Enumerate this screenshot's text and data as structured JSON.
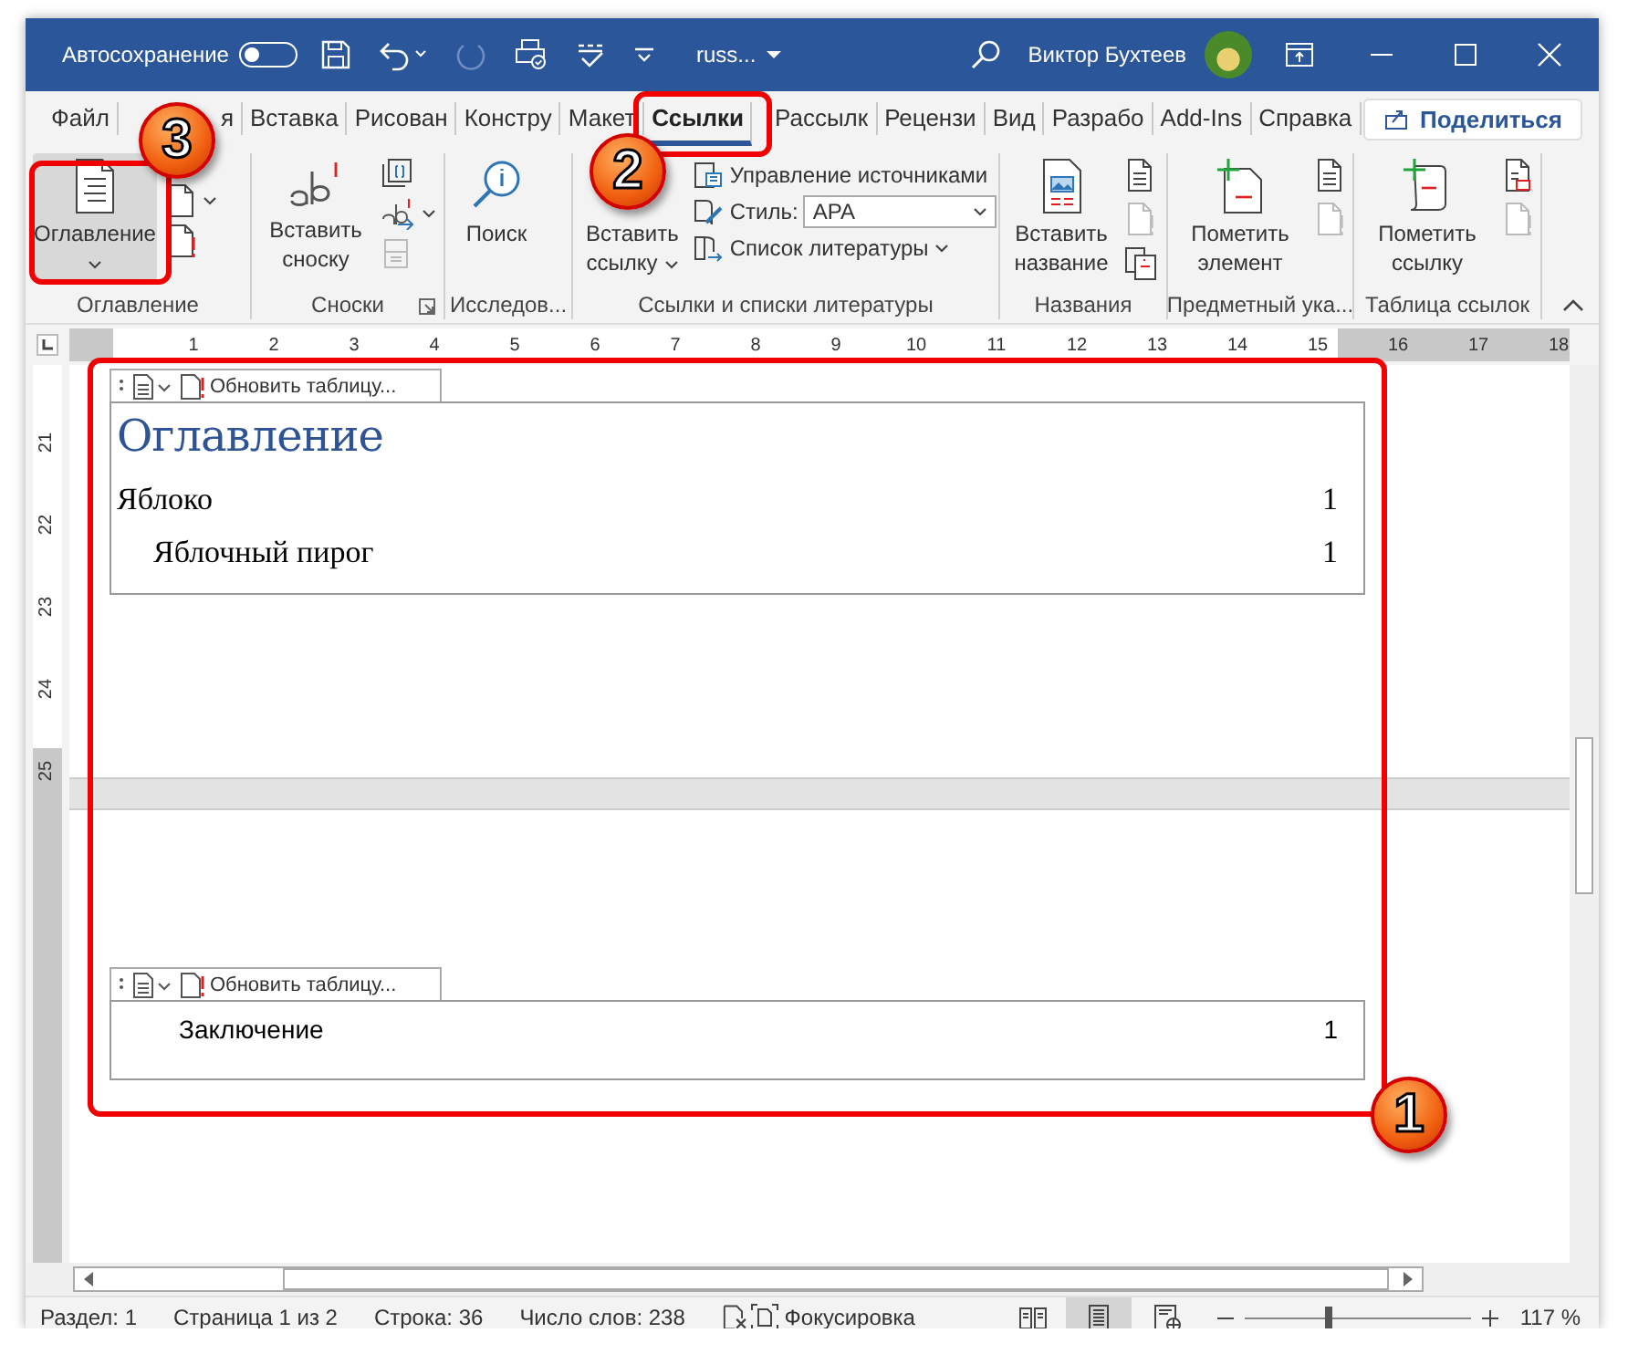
{
  "title_bar": {
    "autosave": {
      "label": "Автосохранение",
      "on": false
    },
    "document_name": "russ...",
    "user_name": "Виктор Бухтеев"
  },
  "tabs": [
    {
      "label": "Файл",
      "selected": false
    },
    {
      "label": "я",
      "selected": false
    },
    {
      "label": "Вставка",
      "selected": false
    },
    {
      "label": "Рисован",
      "selected": false
    },
    {
      "label": "Констру",
      "selected": false
    },
    {
      "label": "Макет",
      "selected": false
    },
    {
      "label": "Ссылки",
      "selected": true
    },
    {
      "label": "Рассылк",
      "selected": false
    },
    {
      "label": "Рецензи",
      "selected": false
    },
    {
      "label": "Вид",
      "selected": false
    },
    {
      "label": "Разрабо",
      "selected": false
    },
    {
      "label": "Add-Ins",
      "selected": false
    },
    {
      "label": "Справка",
      "selected": false
    }
  ],
  "share_button": "Поделиться",
  "ribbon": {
    "groups": [
      {
        "kind": "toc",
        "label": "Оглавление",
        "button": {
          "label": "Оглавление",
          "dropdown": true,
          "pressed": true
        }
      },
      {
        "kind": "footnotes",
        "label": "Сноски",
        "launcher": true,
        "button": {
          "label": "Вставить сноску",
          "pressed": false
        }
      },
      {
        "kind": "research",
        "label": "Исследов...",
        "button": {
          "label": "Поиск",
          "pressed": false
        }
      },
      {
        "kind": "citations",
        "label": "Ссылки и списки литературы",
        "button": {
          "label": "Вставить ссылку",
          "dropdown": true,
          "pressed": false
        },
        "rows": [
          {
            "kind": "manage",
            "label": "Управление источниками"
          },
          {
            "kind": "style",
            "label": "Стиль:",
            "value": "APA"
          },
          {
            "kind": "bibliography",
            "label": "Список литературы"
          }
        ]
      },
      {
        "kind": "captions",
        "label": "Названия",
        "button": {
          "label": "Вставить название",
          "pressed": false
        }
      },
      {
        "kind": "index",
        "label": "Предметный ука...",
        "button": {
          "label": "Пометить элемент",
          "pressed": false
        }
      },
      {
        "kind": "authorities",
        "label": "Таблица ссылок",
        "button": {
          "label": "Пометить ссылку",
          "pressed": false
        }
      }
    ]
  },
  "ruler": [
    "1",
    "2",
    "3",
    "4",
    "5",
    "6",
    "7",
    "8",
    "9",
    "10",
    "11",
    "12",
    "13",
    "14",
    "15",
    "16",
    "17",
    "18"
  ],
  "vertical_ruler": [
    "21",
    "22",
    "23",
    "24",
    "25"
  ],
  "document": {
    "pages": [
      {
        "toc": {
          "kind": "styled",
          "toolbar_button": "Обновить таблицу...",
          "heading": "Оглавление",
          "entries": [
            {
              "text": "Яблоко",
              "page": "1",
              "children": [
                {
                  "text": "Яблочный пирог",
                  "page": "1"
                }
              ]
            }
          ]
        }
      },
      {
        "toc": {
          "kind": "plain",
          "toolbar_button": "Обновить таблицу...",
          "entries": [
            {
              "text": "Заключение",
              "page": "1"
            }
          ]
        }
      }
    ]
  },
  "status_bar": {
    "items": [
      "Раздел: 1",
      "Страница 1 из 2",
      "Строка: 36",
      "Число слов: 238"
    ],
    "focus": "Фокусировка",
    "views": [
      {
        "kind": "read",
        "selected": false
      },
      {
        "kind": "print",
        "selected": true
      },
      {
        "kind": "web",
        "selected": false
      }
    ],
    "zoom": {
      "level": 0.37,
      "reading": "117 %"
    }
  },
  "callouts": [
    {
      "number": "1"
    },
    {
      "number": "2"
    },
    {
      "number": "3"
    }
  ]
}
